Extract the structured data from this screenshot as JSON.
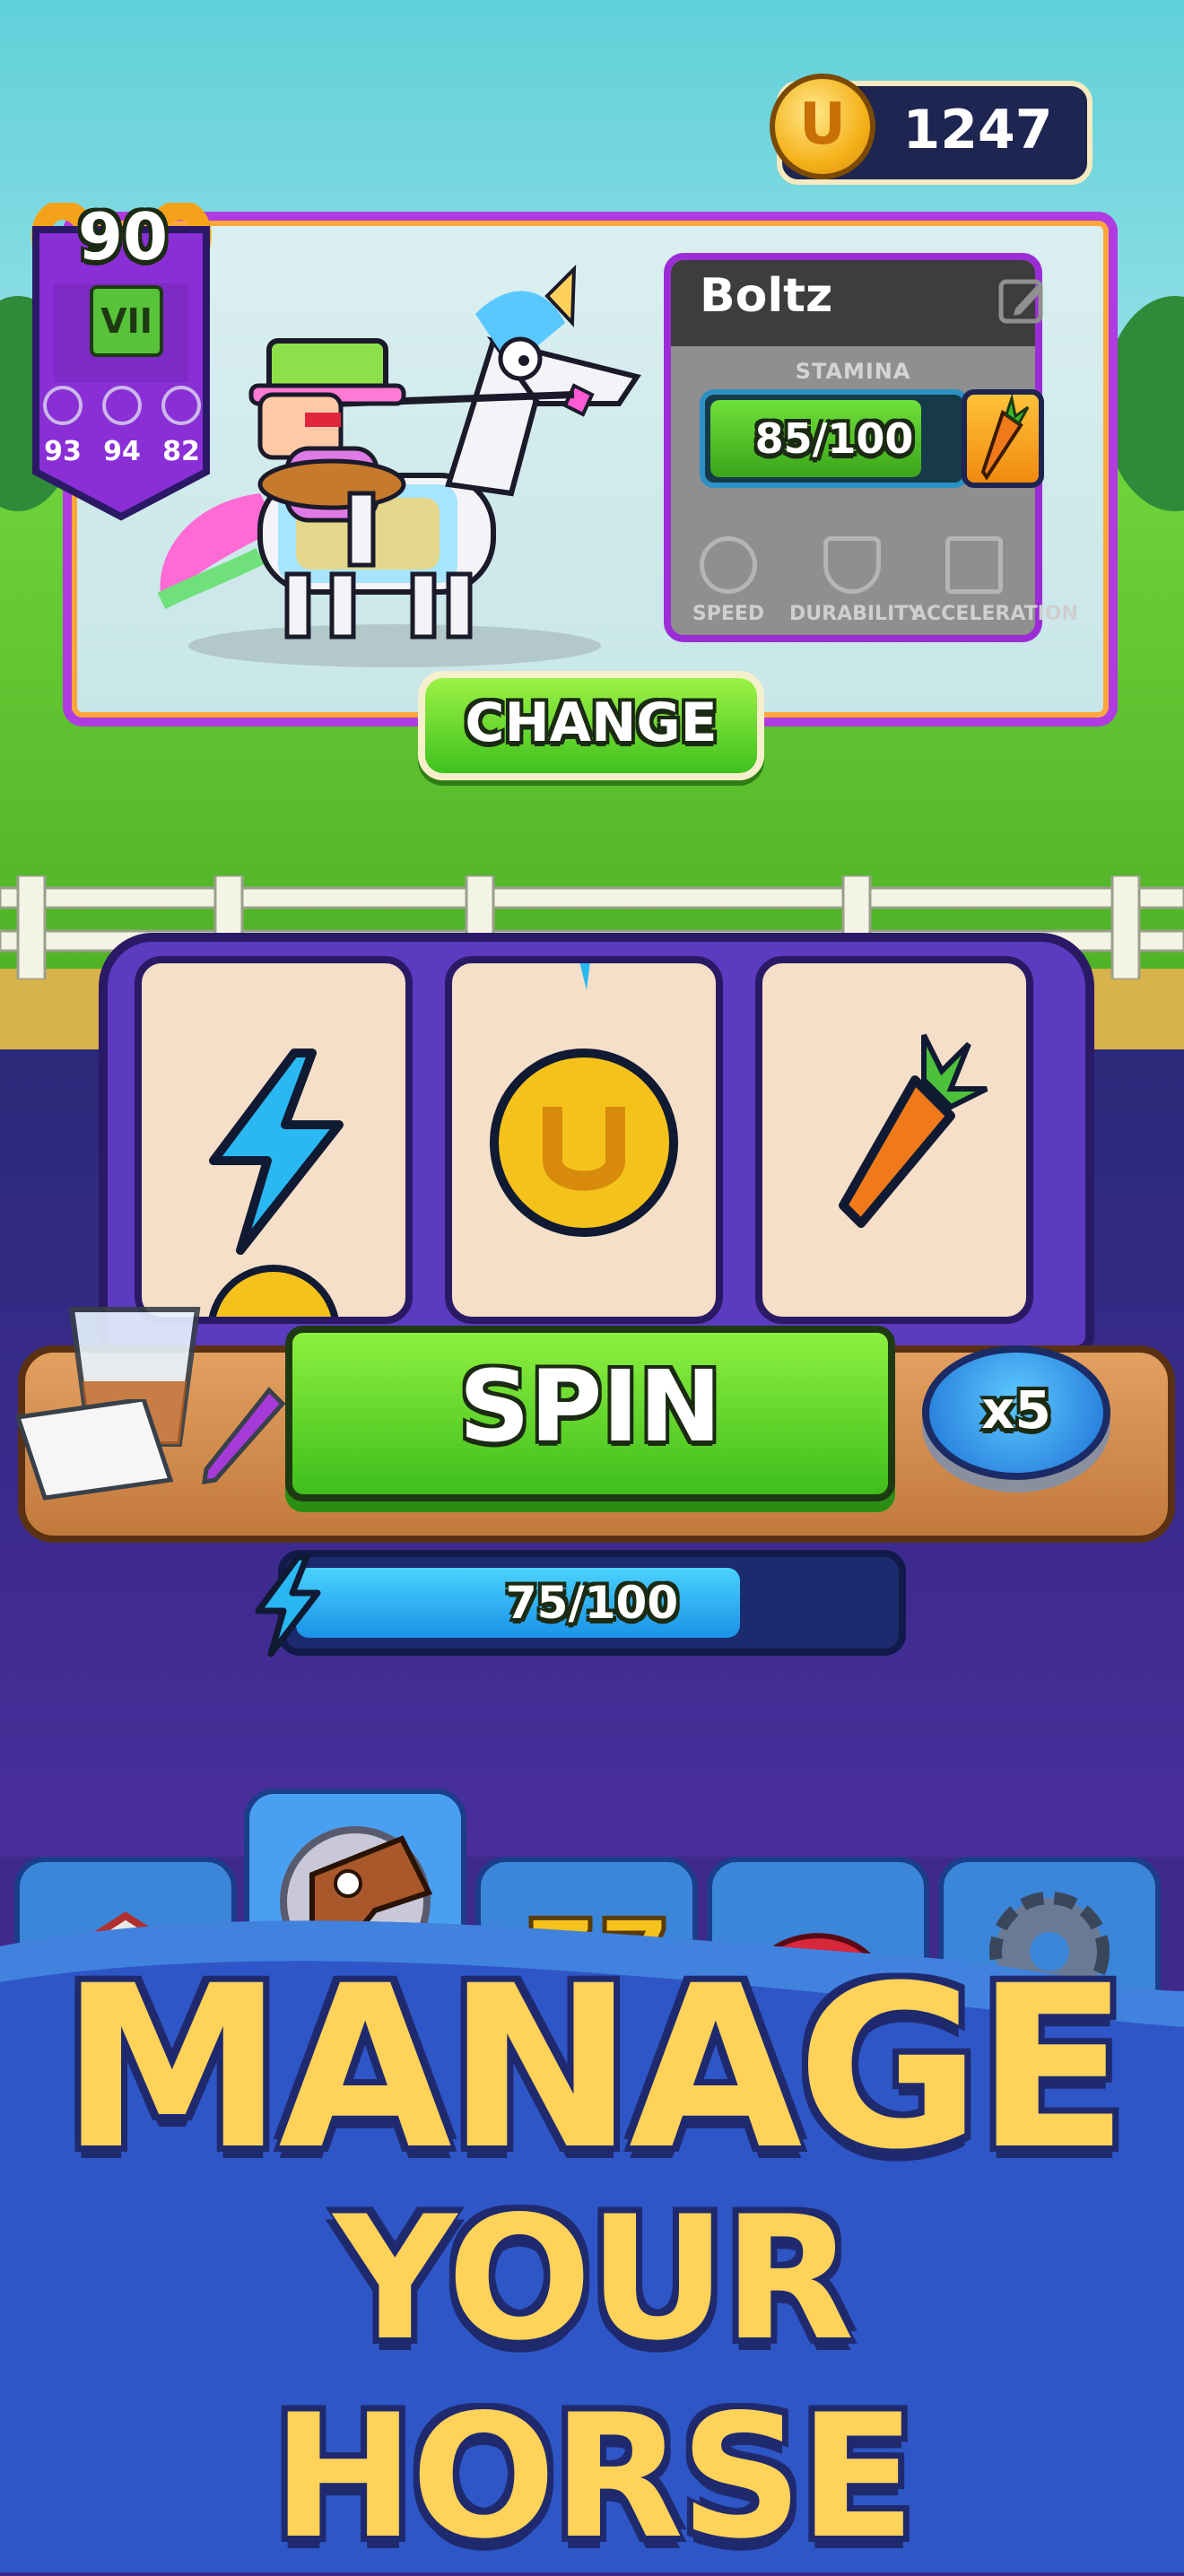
{
  "currency": {
    "coins": "1247"
  },
  "badge": {
    "level": "90",
    "rank": "VII",
    "stats": [
      "93",
      "94",
      "82"
    ]
  },
  "horse": {
    "name": "Boltz",
    "stamina_label": "STAMINA",
    "stamina_text": "85/100",
    "stamina_fraction": 0.85,
    "stat_labels": [
      "SPEED",
      "DURABILITY",
      "ACCELERATION"
    ]
  },
  "actions": {
    "change_label": "CHANGE",
    "spin_label": "SPIN",
    "multiplier_label": "x5"
  },
  "reels": [
    "lightning-bolt-icon",
    "horseshoe-coin-icon",
    "carrot-icon"
  ],
  "energy": {
    "text": "75/100",
    "fraction": 0.75
  },
  "nav": [
    "stable-tab",
    "horse-tab",
    "slots-tab",
    "items-tab",
    "settings-tab"
  ],
  "banner": {
    "line1": "MANAGE",
    "line2": "YOUR HORSE"
  },
  "colors": {
    "accent_green": "#3fbe1c",
    "accent_purple": "#9b2dd4",
    "coin_gold": "#f5b21b",
    "banner_blue": "#2f56c6"
  }
}
